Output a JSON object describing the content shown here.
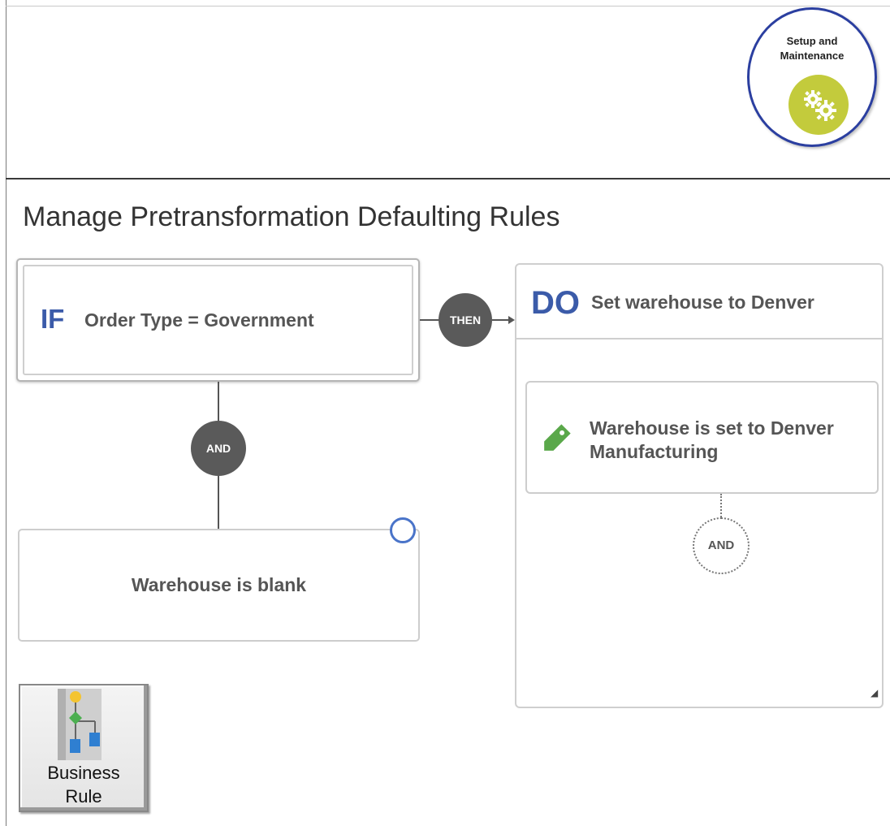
{
  "header": {
    "setup_badge": {
      "line1": "Setup and",
      "line2": "Maintenance",
      "icon": "gears-icon",
      "color": "#c3cb3c"
    }
  },
  "page": {
    "title": "Manage Pretransformation Defaulting Rules"
  },
  "rule": {
    "if_keyword": "IF",
    "if_condition": "Order Type = Government",
    "then_label": "THEN",
    "and_label": "AND",
    "second_condition": "Warehouse is blank",
    "do_keyword": "DO",
    "do_title": "Set warehouse to Denver",
    "action": {
      "line1": "Warehouse is set to Denver",
      "line2": "Manufacturing",
      "icon": "tag-icon"
    },
    "add_and_label": "AND"
  },
  "toolbar": {
    "business_rule": {
      "line1": "Business",
      "line2": "Rule",
      "icon": "business-rule-flow-icon"
    }
  },
  "colors": {
    "keyword": "#3b5ba9",
    "node": "#5a5a5a",
    "badge_border": "#2b3fa0",
    "tag": "#5aa84a",
    "handle": "#4a74c9"
  }
}
